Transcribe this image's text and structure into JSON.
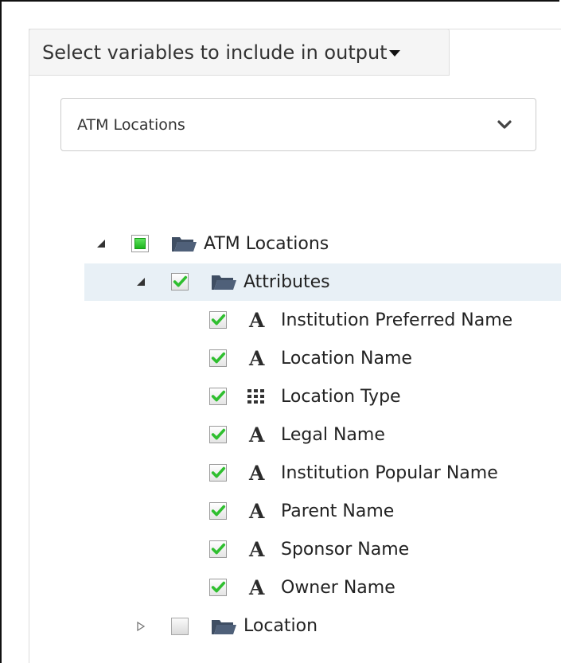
{
  "panel": {
    "header_label": "Select variables to include in output"
  },
  "dataset_select": {
    "selected": "ATM Locations"
  },
  "tree": {
    "root": {
      "label": "ATM Locations",
      "state": "partial",
      "expanded": true
    },
    "attributes": {
      "label": "Attributes",
      "state": "checked",
      "expanded": true
    },
    "fields": [
      {
        "label": "Institution Preferred Name",
        "type": "text-icon",
        "glyph": "A",
        "state": "checked"
      },
      {
        "label": "Location Name",
        "type": "text-icon",
        "glyph": "A",
        "state": "checked"
      },
      {
        "label": "Location Type",
        "type": "category-icon",
        "glyph": "",
        "state": "checked"
      },
      {
        "label": "Legal Name",
        "type": "text-icon",
        "glyph": "A",
        "state": "checked"
      },
      {
        "label": "Institution Popular Name",
        "type": "text-icon",
        "glyph": "A",
        "state": "checked"
      },
      {
        "label": "Parent Name",
        "type": "text-icon",
        "glyph": "A",
        "state": "checked"
      },
      {
        "label": "Sponsor Name",
        "type": "text-icon",
        "glyph": "A",
        "state": "checked"
      },
      {
        "label": "Owner Name",
        "type": "text-icon",
        "glyph": "A",
        "state": "checked"
      }
    ],
    "location": {
      "label": "Location",
      "state": "unchecked",
      "expanded": false
    }
  },
  "colors": {
    "check_green": "#2fbf2f",
    "folder_blue": "#44546a",
    "highlight": "#e8f0f6"
  }
}
